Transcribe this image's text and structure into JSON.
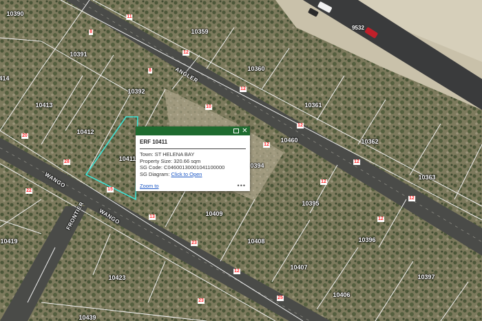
{
  "map": {
    "parcels": [
      "10390",
      "10359",
      "10391",
      "414",
      "10360",
      "10392",
      "10413",
      "10361",
      "10412",
      "10460",
      "10362",
      "10411",
      "10394",
      "10363",
      "10395",
      "10409",
      "10396",
      "10419",
      "10408",
      "10407",
      "10397",
      "10423",
      "10406",
      "10439"
    ],
    "streets": [
      "ANGLER",
      "WANGO",
      "WANGO",
      "FRONTIER"
    ],
    "dimensions": [
      "8",
      "12",
      "12",
      "8",
      "20",
      "11",
      "12",
      "10",
      "28",
      "12",
      "12",
      "12",
      "15",
      "13",
      "22",
      "23",
      "12",
      "12",
      "12",
      "25",
      "23",
      "9532"
    ],
    "colors": {
      "parcel_line": "#f2f2f2",
      "selected_outline": "#3ee6d9",
      "dimension_text": "#ff2a2a",
      "road": "#3a3b3c"
    }
  },
  "popup": {
    "title": "ERF 10411",
    "town_label": "Town:",
    "town_value": "ST HELENA BAY",
    "size_label": "Property Size:",
    "size_value": "320.66 sqm",
    "sg_code_label": "SG Code:",
    "sg_code_value": "C04600130001041100000",
    "sg_diagram_label": "SG Diagram:",
    "sg_diagram_link": "Click to Open",
    "zoom_label": "Zoom to",
    "more_label": "•••",
    "maximize_icon": "restore-icon",
    "close_icon": "close-icon",
    "header_color": "#1e6b2f"
  }
}
